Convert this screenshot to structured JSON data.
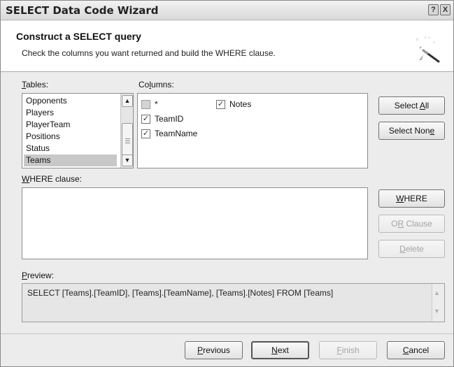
{
  "window": {
    "title": "SELECT Data Code Wizard",
    "help_glyph": "?",
    "close_glyph": "X"
  },
  "header": {
    "title": "Construct a SELECT query",
    "subtitle": "Check the columns you want returned and build the WHERE clause.",
    "icon": "wizard-wand-icon"
  },
  "tables": {
    "label": "Tables:",
    "label_accel": "T",
    "label_rest": "ables:",
    "items": [
      "Opponents",
      "Players",
      "PlayerTeam",
      "Positions",
      "Status",
      "Teams"
    ],
    "selected": "Teams"
  },
  "columns": {
    "label": "Columns:",
    "label_pre": "Co",
    "label_accel": "l",
    "label_rest": "umns:",
    "items": [
      {
        "label": "*",
        "checked": false
      },
      {
        "label": "TeamID",
        "checked": true
      },
      {
        "label": "TeamName",
        "checked": true
      },
      {
        "label": "Notes",
        "checked": true
      }
    ]
  },
  "buttons": {
    "select_all_pre": "Select ",
    "select_all_accel": "A",
    "select_all_rest": "ll",
    "select_none_pre": "Select Non",
    "select_none_accel": "e",
    "where_accel": "W",
    "where_rest": "HERE",
    "or_pre": "O",
    "or_accel": "R",
    "or_rest": " Clause",
    "delete_accel": "D",
    "delete_rest": "elete",
    "previous_accel": "P",
    "previous_rest": "revious",
    "next_accel": "N",
    "next_rest": "ext",
    "finish_accel": "F",
    "finish_rest": "inish",
    "cancel_accel": "C",
    "cancel_rest": "ancel"
  },
  "where": {
    "label": "WHERE clause:",
    "label_accel": "W",
    "label_rest": "HERE clause:",
    "value": ""
  },
  "preview": {
    "label": "Preview:",
    "label_accel": "P",
    "label_rest": "review:",
    "sql": "SELECT [Teams].[TeamID], [Teams].[TeamName], [Teams].[Notes] FROM [Teams]"
  },
  "colors": {
    "window_bg": "#ececec",
    "selected_row": "#c8c8c8",
    "disabled_text": "#a3a3a3"
  }
}
